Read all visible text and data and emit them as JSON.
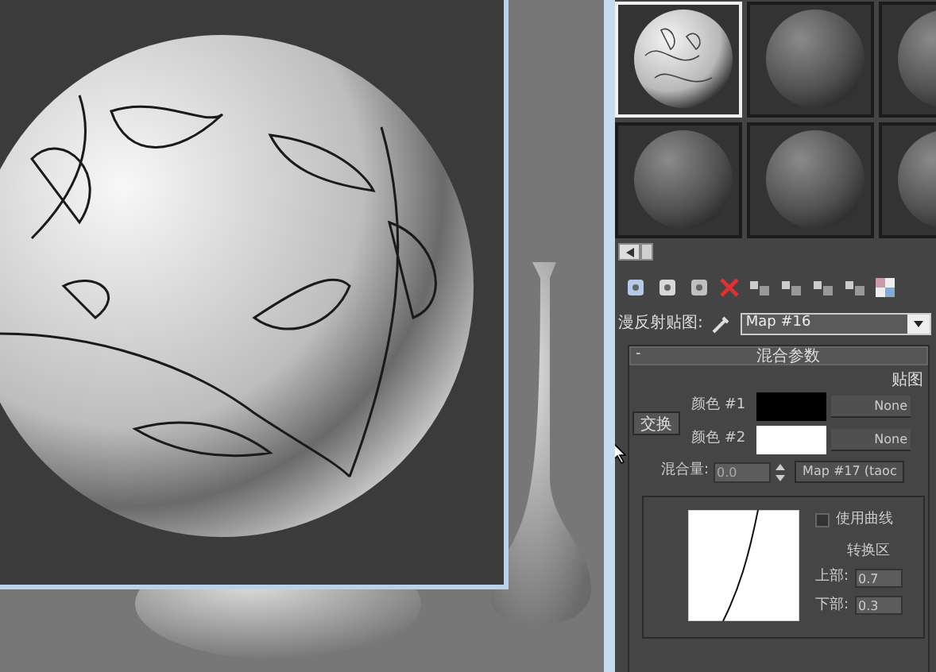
{
  "material_slots": [
    {
      "selected": true,
      "patterned": true
    },
    {
      "selected": false,
      "patterned": false
    },
    {
      "selected": false,
      "patterned": false
    },
    {
      "selected": false,
      "patterned": false
    },
    {
      "selected": false,
      "patterned": false
    },
    {
      "selected": false,
      "patterned": false
    }
  ],
  "diffuse_map": {
    "label": "漫反射贴图:",
    "value": "Map #16"
  },
  "rollout": {
    "title": "混合参数",
    "collapse": "-",
    "map_heading": "贴图",
    "swap_button": "交换",
    "colors": [
      {
        "label": "颜色 #1",
        "color": "#000000",
        "map": "None"
      },
      {
        "label": "颜色 #2",
        "color": "#ffffff",
        "map": "None"
      }
    ],
    "mix_amount": {
      "label": "混合量:",
      "value": "0.0",
      "map": "Map #17 (taoc"
    },
    "use_curve": {
      "label": "使用曲线",
      "checked": false
    },
    "transition_zone": {
      "title": "转换区",
      "upper_label": "上部:",
      "upper": "0.7",
      "lower_label": "下部:",
      "lower": "0.3"
    }
  }
}
